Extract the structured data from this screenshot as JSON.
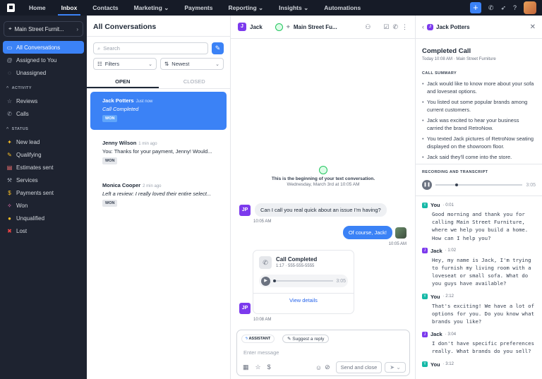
{
  "topnav": {
    "items": [
      "Home",
      "Inbox",
      "Contacts",
      "Marketing",
      "Payments",
      "Reporting",
      "Insights",
      "Automations"
    ],
    "dropdown_marker": "⌄",
    "plus_label": "+"
  },
  "sidebar": {
    "location": "Main Street Furnit...",
    "main_items": [
      "All Conversations",
      "Assigned to You",
      "Unassigned"
    ],
    "activity_head": "ACTIVITY",
    "activity_items": [
      "Reviews",
      "Calls"
    ],
    "status_head": "STATUS",
    "status_items": [
      "New lead",
      "Qualifying",
      "Estimates sent",
      "Services",
      "Payments sent",
      "Won",
      "Unqualified",
      "Lost"
    ]
  },
  "conversations": {
    "title": "All Conversations",
    "search_placeholder": "Search",
    "filters_label": "Filters",
    "sort_label": "Newest",
    "tab_open": "OPEN",
    "tab_closed": "CLOSED",
    "items": [
      {
        "name": "Jack Potters",
        "time": "Just now",
        "preview": "Call Completed",
        "badge": "WON"
      },
      {
        "name": "Jenny Wilson",
        "time": "1 min ago",
        "preview": "You: Thanks for your payment, Jenny! Would...",
        "badge": "WON"
      },
      {
        "name": "Monica Cooper",
        "time": "2 min ago",
        "preview": "Left a review: I really loved their entire select...",
        "badge": "WON"
      }
    ]
  },
  "chat": {
    "contact_initial": "J",
    "contact_name": "Jack",
    "location": "Main Street Fu...",
    "begin_text": "This is the beginning of your text conversation.",
    "begin_date": "Wednesday, March 3rd at 10:05 AM",
    "msg1": {
      "initials": "JP",
      "text": "Can I call you real quick about an issue I'm having?",
      "time": "10:05 AM"
    },
    "msg2": {
      "text": "Of course, Jack!",
      "time": "10:05 AM"
    },
    "call": {
      "initials": "JP",
      "title": "Call Completed",
      "meta": "1:17 · 555-555-5555",
      "duration": "3:05",
      "link": "View details",
      "time": "10:08 AM"
    },
    "composer": {
      "assistant": "ASSISTANT",
      "suggest": "Suggest a reply",
      "placeholder": "Enter message",
      "send_close": "Send and close"
    }
  },
  "details": {
    "name": "Jack Potters",
    "initial": "J",
    "title": "Completed Call",
    "subtitle": "Today 10:08 AM · Main Street Furniture",
    "summary_head": "CALL SUMMARY",
    "summary": [
      "Jack would like to know more about your sofa and loveseat options.",
      "You listed out some popular brands among current customers.",
      "Jack was excited to hear your business carried the brand RetroNow.",
      "You texted Jack pictures of RetroNow seating displayed on the showroom floor.",
      "Jack said they'll come into the store."
    ],
    "recording_head": "RECORDING AND TRANSCRIPT",
    "recording_duration": "3:05",
    "transcript": [
      {
        "speaker": "You",
        "time": "· 0:01",
        "text": "Good morning and thank you for calling Main Street Furniture, where we help you build a home. How can I help you?"
      },
      {
        "speaker": "Jack",
        "time": "· 1:02",
        "text": "Hey, my name is Jack, I'm trying to furnish my living room with a loveseat or small sofa. What do you guys have available?"
      },
      {
        "speaker": "You",
        "time": "· 2:12",
        "text": "That's exciting! We have a lot of options for you. Do you know what brands you like?"
      },
      {
        "speaker": "Jack",
        "time": "· 3:04",
        "text": "I don't have specific preferences really. What brands do you sell?"
      },
      {
        "speaker": "You",
        "time": "· 3:12",
        "text": ""
      }
    ]
  },
  "colors": {
    "accent": "#3b82f6",
    "nav_bg": "#161b27",
    "sidebar_bg": "#1e2330",
    "purple": "#7c3aed",
    "teal": "#14b8a6"
  }
}
